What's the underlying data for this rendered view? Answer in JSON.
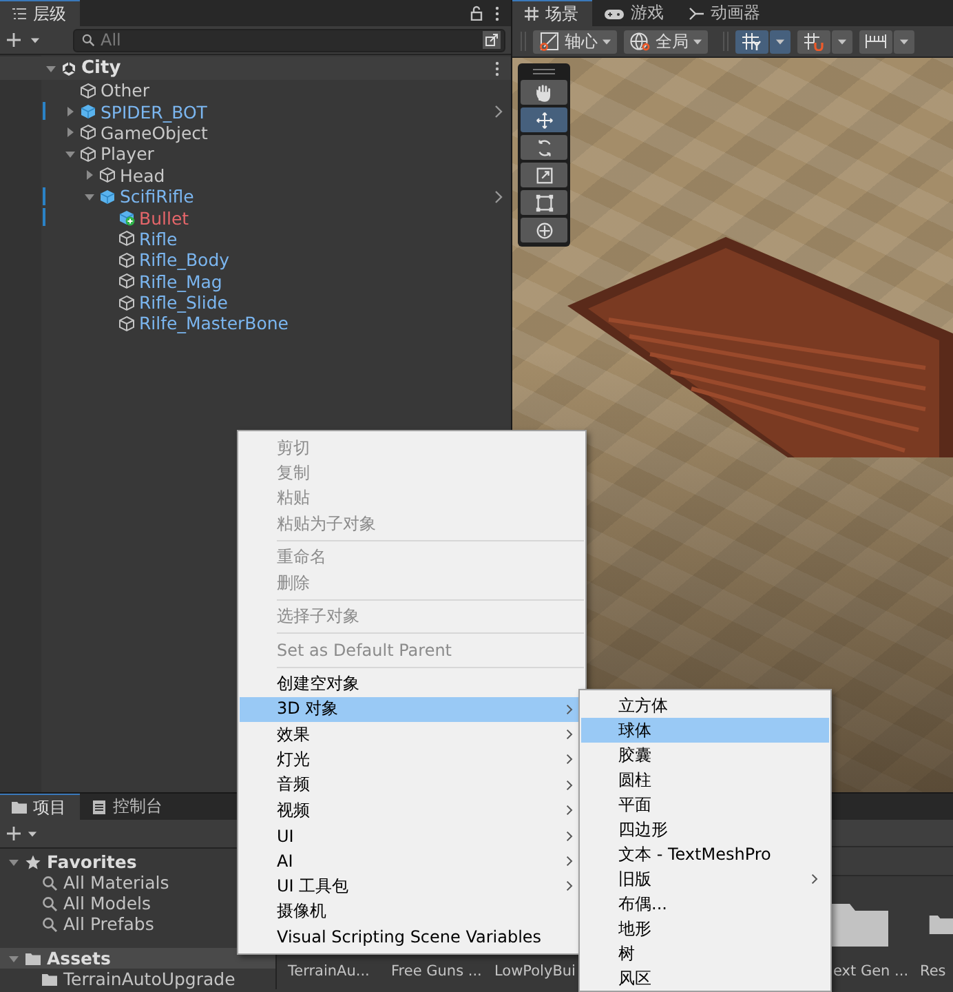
{
  "hierarchy": {
    "tab": {
      "label": "层级",
      "selected": true
    },
    "search": {
      "placeholder": "All"
    },
    "tree": [
      {
        "name": "City",
        "kind": "scene",
        "expanded": true,
        "children": [
          {
            "name": "Other",
            "kind": "object"
          },
          {
            "name": "SPIDER_BOT",
            "kind": "prefab",
            "expanded": false
          },
          {
            "name": "GameObject",
            "kind": "object",
            "expanded": false
          },
          {
            "name": "Player",
            "kind": "object",
            "expanded": true,
            "children": [
              {
                "name": "Head",
                "kind": "object",
                "expanded": false
              },
              {
                "name": "ScifiRifle",
                "kind": "prefab",
                "expanded": true,
                "children": [
                  {
                    "name": "Bullet",
                    "kind": "added"
                  },
                  {
                    "name": "Rifle",
                    "kind": "prefab_part"
                  },
                  {
                    "name": "Rifle_Body",
                    "kind": "prefab_part"
                  },
                  {
                    "name": "Rifle_Mag",
                    "kind": "prefab_part"
                  },
                  {
                    "name": "Rifle_Slide",
                    "kind": "prefab_part"
                  },
                  {
                    "name": "Rilfe_MasterBone",
                    "kind": "prefab_part"
                  }
                ]
              }
            ]
          }
        ]
      }
    ]
  },
  "scene": {
    "tabs": [
      {
        "label": "场景",
        "kind": "scene",
        "selected": true
      },
      {
        "label": "游戏",
        "kind": "game",
        "selected": false
      },
      {
        "label": "动画器",
        "kind": "animator",
        "selected": false
      }
    ],
    "toolbar": [
      {
        "kind": "pivot",
        "label": "轴心",
        "selected": false
      },
      {
        "kind": "global",
        "label": "全局",
        "selected": false
      },
      {
        "kind": "grid",
        "selected": true
      },
      {
        "kind": "snap",
        "selected": false
      },
      {
        "kind": "increment",
        "selected": false
      }
    ],
    "tools": [
      {
        "kind": "hand",
        "selected": false
      },
      {
        "kind": "move",
        "selected": true
      },
      {
        "kind": "rotate",
        "selected": false
      },
      {
        "kind": "scale",
        "selected": false
      },
      {
        "kind": "rect",
        "selected": false
      },
      {
        "kind": "transform",
        "selected": false
      }
    ]
  },
  "project": {
    "tabs": [
      {
        "label": "项目",
        "kind": "folder",
        "selected": true
      },
      {
        "label": "控制台",
        "kind": "console",
        "selected": false
      }
    ],
    "tree": [
      {
        "name": "Favorites",
        "kind": "favorites",
        "expanded": true,
        "selected": false,
        "children": [
          {
            "name": "All Materials",
            "kind": "search",
            "selected": false
          },
          {
            "name": "All Models",
            "kind": "search",
            "selected": false
          },
          {
            "name": "All Prefabs",
            "kind": "search",
            "selected": false
          }
        ]
      },
      {
        "name": "Assets",
        "kind": "folder",
        "expanded": true,
        "selected": true,
        "children": [
          {
            "name": "TerrainAutoUpgrade",
            "kind": "folder",
            "selected": false
          }
        ]
      }
    ],
    "assets": [
      {
        "label": "TerrainAu..."
      },
      {
        "label": "Free Guns ..."
      },
      {
        "label": "LowPolyBui"
      },
      {
        "label": "ext Gen ..."
      },
      {
        "label": "Res"
      }
    ]
  },
  "context_menu": {
    "items": [
      {
        "kind": "item",
        "label": "剪切",
        "disabled": true,
        "selected": false,
        "submenu": false
      },
      {
        "kind": "item",
        "label": "复制",
        "disabled": true,
        "selected": false,
        "submenu": false
      },
      {
        "kind": "item",
        "label": "粘贴",
        "disabled": true,
        "selected": false,
        "submenu": false
      },
      {
        "kind": "item",
        "label": "粘贴为子对象",
        "disabled": true,
        "selected": false,
        "submenu": false
      },
      {
        "kind": "separator"
      },
      {
        "kind": "item",
        "label": "重命名",
        "disabled": true,
        "selected": false,
        "submenu": false
      },
      {
        "kind": "item",
        "label": "删除",
        "disabled": true,
        "selected": false,
        "submenu": false
      },
      {
        "kind": "separator"
      },
      {
        "kind": "item",
        "label": "选择子对象",
        "disabled": true,
        "selected": false,
        "submenu": false
      },
      {
        "kind": "separator"
      },
      {
        "kind": "item",
        "label": "Set as Default Parent",
        "disabled": true,
        "selected": false,
        "submenu": false
      },
      {
        "kind": "separator"
      },
      {
        "kind": "item",
        "label": "创建空对象",
        "disabled": false,
        "selected": false,
        "submenu": false
      },
      {
        "kind": "item",
        "label": "3D 对象",
        "disabled": false,
        "selected": true,
        "submenu": true
      },
      {
        "kind": "item",
        "label": "效果",
        "disabled": false,
        "selected": false,
        "submenu": true
      },
      {
        "kind": "item",
        "label": "灯光",
        "disabled": false,
        "selected": false,
        "submenu": true
      },
      {
        "kind": "item",
        "label": "音频",
        "disabled": false,
        "selected": false,
        "submenu": true
      },
      {
        "kind": "item",
        "label": "视频",
        "disabled": false,
        "selected": false,
        "submenu": true
      },
      {
        "kind": "item",
        "label": "UI",
        "disabled": false,
        "selected": false,
        "submenu": true
      },
      {
        "kind": "item",
        "label": "AI",
        "disabled": false,
        "selected": false,
        "submenu": true
      },
      {
        "kind": "item",
        "label": "UI 工具包",
        "disabled": false,
        "selected": false,
        "submenu": true
      },
      {
        "kind": "item",
        "label": "摄像机",
        "disabled": false,
        "selected": false,
        "submenu": false
      },
      {
        "kind": "item",
        "label": "Visual Scripting Scene Variables",
        "disabled": false,
        "selected": false,
        "submenu": false
      }
    ]
  },
  "submenu": {
    "items": [
      {
        "kind": "item",
        "label": "立方体",
        "disabled": false,
        "selected": false,
        "submenu": false
      },
      {
        "kind": "item",
        "label": "球体",
        "disabled": false,
        "selected": true,
        "submenu": false
      },
      {
        "kind": "item",
        "label": "胶囊",
        "disabled": false,
        "selected": false,
        "submenu": false
      },
      {
        "kind": "item",
        "label": "圆柱",
        "disabled": false,
        "selected": false,
        "submenu": false
      },
      {
        "kind": "item",
        "label": "平面",
        "disabled": false,
        "selected": false,
        "submenu": false
      },
      {
        "kind": "item",
        "label": "四边形",
        "disabled": false,
        "selected": false,
        "submenu": false
      },
      {
        "kind": "item",
        "label": "文本 - TextMeshPro",
        "disabled": false,
        "selected": false,
        "submenu": false
      },
      {
        "kind": "item",
        "label": "旧版",
        "disabled": false,
        "selected": false,
        "submenu": true
      },
      {
        "kind": "item",
        "label": "布偶...",
        "disabled": false,
        "selected": false,
        "submenu": false
      },
      {
        "kind": "item",
        "label": "地形",
        "disabled": false,
        "selected": false,
        "submenu": false
      },
      {
        "kind": "item",
        "label": "树",
        "disabled": false,
        "selected": false,
        "submenu": false
      },
      {
        "kind": "item",
        "label": "风区",
        "disabled": false,
        "selected": false,
        "submenu": false
      }
    ]
  }
}
